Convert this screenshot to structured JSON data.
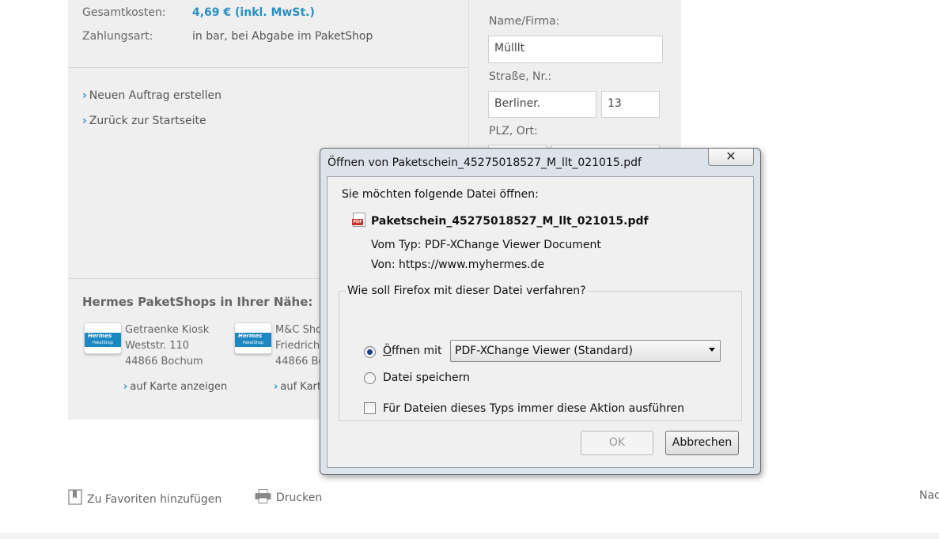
{
  "order": {
    "total_label": "Gesamtkosten:",
    "total_value": "4,69 € (inkl. MwSt.)",
    "payment_label": "Zahlungsart:",
    "payment_value": "in bar, bei Abgabe im PaketShop"
  },
  "links": {
    "new_order": "Neuen Auftrag erstellen",
    "back_home": "Zurück zur Startseite"
  },
  "shops": {
    "title": "Hermes PaketShops in Ihrer Nähe:",
    "logo_brand": "Hermes",
    "logo_sub": "PaketShop",
    "items": [
      {
        "name": "Getraenke Kiosk",
        "street": "Weststr. 110",
        "city": "44866 Bochum",
        "map_link": "auf Karte anzeigen"
      },
      {
        "name": "M&C Sho",
        "street": "Friedrich",
        "city": "44866 Bo",
        "map_link": "auf Kart"
      }
    ]
  },
  "form": {
    "name_label": "Name/Firma:",
    "name_value": "Mülllt",
    "street_label": "Straße, Nr.:",
    "street_value": "Berliner.",
    "number_value": "13",
    "zip_label": "PLZ, Ort:"
  },
  "footer": {
    "favorites": "Zu Favoriten hinzufügen",
    "print": "Drucken",
    "next_cut": "Nac"
  },
  "dialog": {
    "title": "Öffnen von Paketschein_45275018527_M_llt_021015.pdf",
    "close_glyph": "✕",
    "prompt": "Sie möchten folgende Datei öffnen:",
    "filename": "Paketschein_45275018527_M_llt_021015.pdf",
    "file_icon_text": "PDF",
    "type_label": "Vom Typ:",
    "type_value": "PDF-XChange Viewer Document",
    "from_label": "Von:",
    "from_value": "https://www.myhermes.de",
    "group_legend": "Wie soll Firefox mit dieser Datei verfahren?",
    "open_with_label": "Öffnen mit",
    "open_with_selected": "PDF-XChange Viewer (Standard)",
    "save_label": "Datei speichern",
    "always_label": "Für Dateien dieses Typs immer diese Aktion ausführen",
    "ok_label": "OK",
    "cancel_label": "Abbrechen"
  },
  "colors": {
    "accent_blue": "#2a8fc1",
    "hermes_blue": "#1d87c2",
    "panel_bg": "#efefef",
    "dialog_frame": "#dde3ea"
  }
}
